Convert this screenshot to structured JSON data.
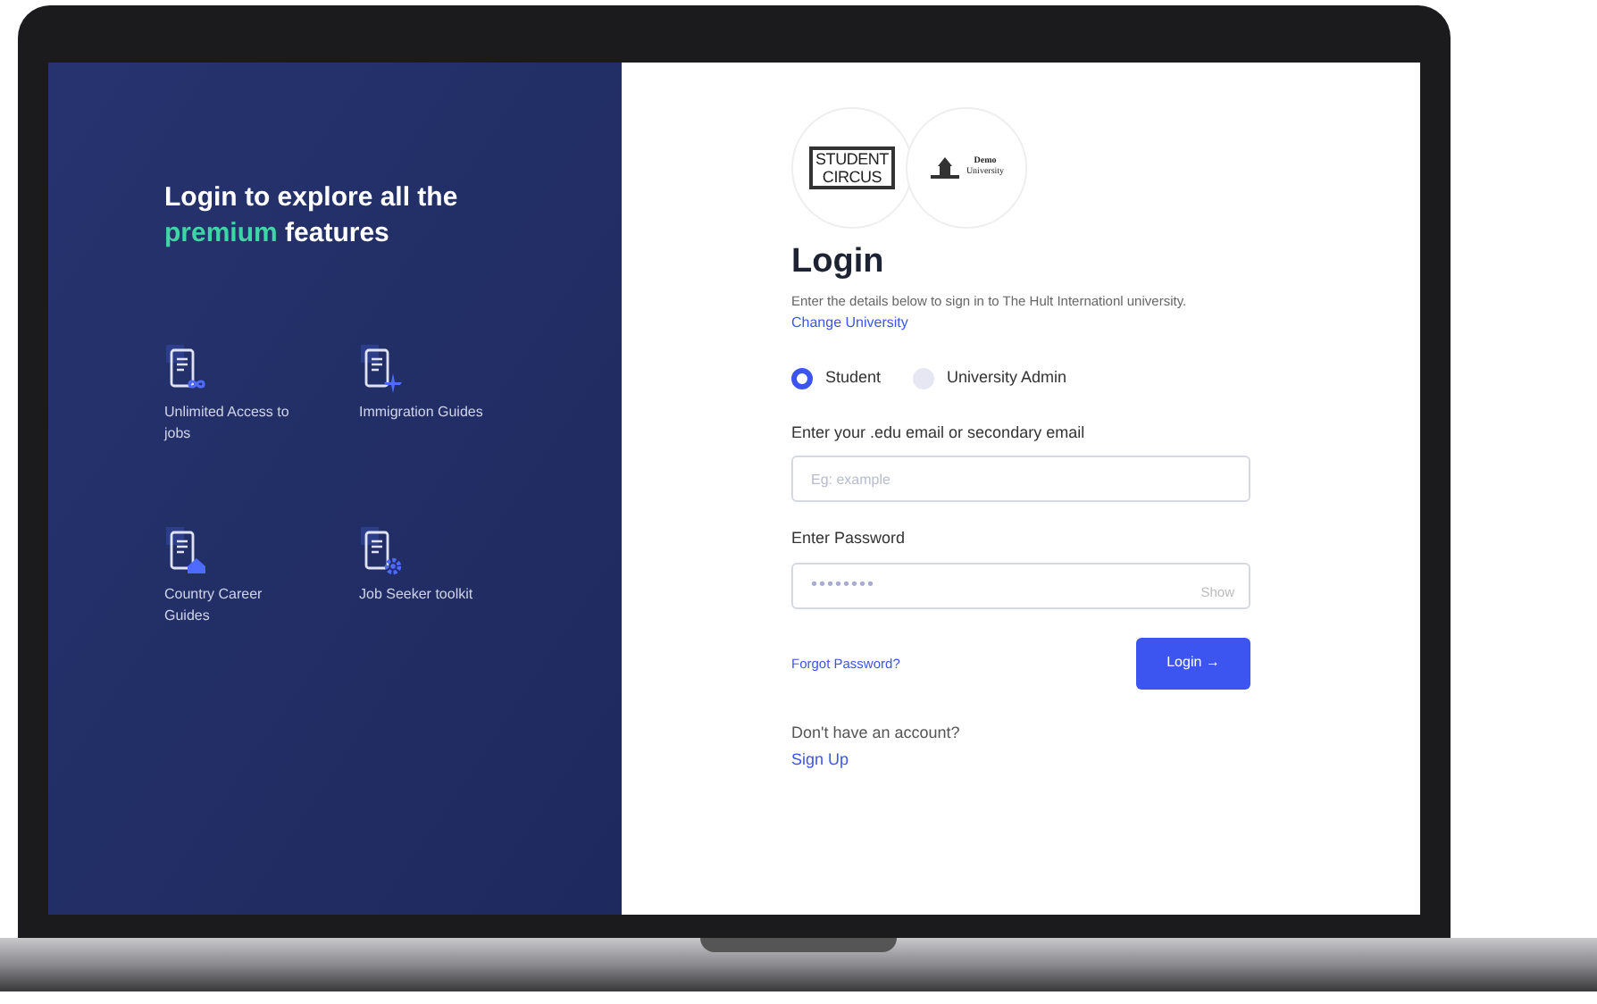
{
  "promo": {
    "heading": "Login to explore all the **premium** features",
    "features": [
      {
        "kind": "infinity",
        "label": "Unlimited Access to jobs"
      },
      {
        "kind": "plane",
        "label": "Immigration Guides"
      },
      {
        "kind": "home",
        "label": "Country Career Guides"
      },
      {
        "kind": "gear",
        "label": "Job Seeker toolkit"
      }
    ]
  },
  "logos": {
    "primary": [
      "STUDENT",
      "CIRCUS"
    ],
    "university": [
      "Demo",
      "University"
    ]
  },
  "login": {
    "title": "Login",
    "description": "Enter the details below to sign in to The Hult Internationl university.",
    "change_link": "Change University",
    "roles": [
      {
        "label": "Student",
        "selected": true
      },
      {
        "label": "University Admin",
        "selected": false
      }
    ],
    "email": {
      "label": "Enter your .edu email or secondary email",
      "placeholder": "Eg: example"
    },
    "password": {
      "label": "Enter Password",
      "value": "••••••••",
      "show": "Show"
    },
    "forgot": "Forgot Password?",
    "submit": "Login →",
    "no_account": "Don't have an account?",
    "signup": "Sign Up"
  }
}
